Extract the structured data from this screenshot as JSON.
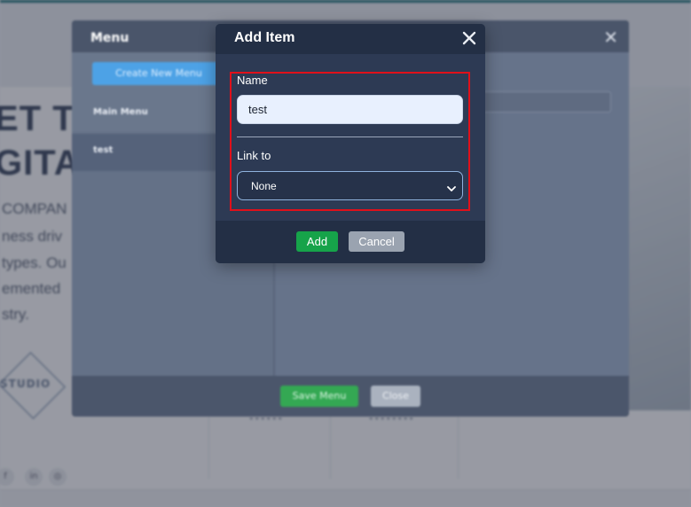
{
  "background_site": {
    "headline_line1": "ET TO",
    "headline_line2": "GITAL",
    "copy_lines": [
      "COMPAN",
      "ness driv",
      "types. Ou",
      "emented",
      "stry."
    ],
    "logo_text": "STUDIO",
    "social_icons": [
      "f",
      "in",
      "◎"
    ],
    "footer_mini": [
      "••••••",
      "••••••••"
    ]
  },
  "menu_modal": {
    "title": "Menu",
    "close_glyph": "✕",
    "create_button": "Create New Menu",
    "items": [
      "Main Menu",
      "test"
    ],
    "save_button": "Save Menu",
    "close_button": "Close"
  },
  "add_item_dialog": {
    "title": "Add Item",
    "close_icon": "close-icon",
    "name_label": "Name",
    "name_value": "test",
    "link_label": "Link to",
    "link_selected": "None",
    "add_button": "Add",
    "cancel_button": "Cancel",
    "colors": {
      "header": "#232f45",
      "body": "#2d3a54",
      "highlight_border": "#e0101a",
      "add_button": "#16a34a",
      "cancel_button": "#9aa3b0"
    }
  }
}
